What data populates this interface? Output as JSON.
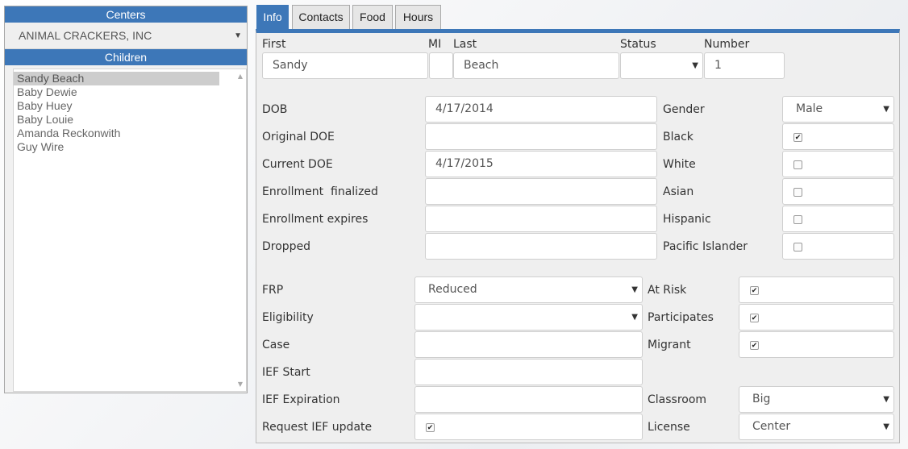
{
  "left": {
    "centers_header": "Centers",
    "centers_value": "ANIMAL CRACKERS, INC",
    "children_header": "Children",
    "children": [
      "Sandy Beach",
      "Baby Dewie",
      "Baby Huey",
      "Baby Louie",
      "Amanda Reckonwith",
      "Guy Wire"
    ]
  },
  "tabs": [
    "Info",
    "Contacts",
    "Food",
    "Hours"
  ],
  "form": {
    "first_label": "First",
    "first_value": "Sandy",
    "mi_label": "MI",
    "mi_value": "",
    "last_label": "Last",
    "last_value": "Beach",
    "status_label": "Status",
    "status_value": "",
    "number_label": "Number",
    "number_value": "1",
    "dob_label": "DOB",
    "dob_value": "4/17/2014",
    "original_doe_label": "Original DOE",
    "original_doe_value": "",
    "current_doe_label": "Current DOE",
    "current_doe_value": "4/17/2015",
    "enrollment_finalized_label": "Enrollment  finalized",
    "enrollment_finalized_value": "",
    "enrollment_expires_label": "Enrollment expires",
    "enrollment_expires_value": "",
    "dropped_label": "Dropped",
    "dropped_value": "",
    "gender_label": "Gender",
    "gender_value": "Male",
    "black_label": "Black",
    "white_label": "White",
    "asian_label": "Asian",
    "hispanic_label": "Hispanic",
    "pacific_label": "Pacific Islander",
    "frp_label": "FRP",
    "frp_value": "Reduced",
    "eligibility_label": "Eligibility",
    "eligibility_value": "",
    "case_label": "Case",
    "case_value": "",
    "ief_start_label": "IEF Start",
    "ief_start_value": "",
    "ief_expiration_label": "IEF Expiration",
    "ief_expiration_value": "",
    "request_ief_label": "Request IEF update",
    "at_risk_label": "At Risk",
    "participates_label": "Participates",
    "migrant_label": "Migrant",
    "classroom_label": "Classroom",
    "classroom_value": "Big",
    "license_label": "License",
    "license_value": "Center"
  }
}
